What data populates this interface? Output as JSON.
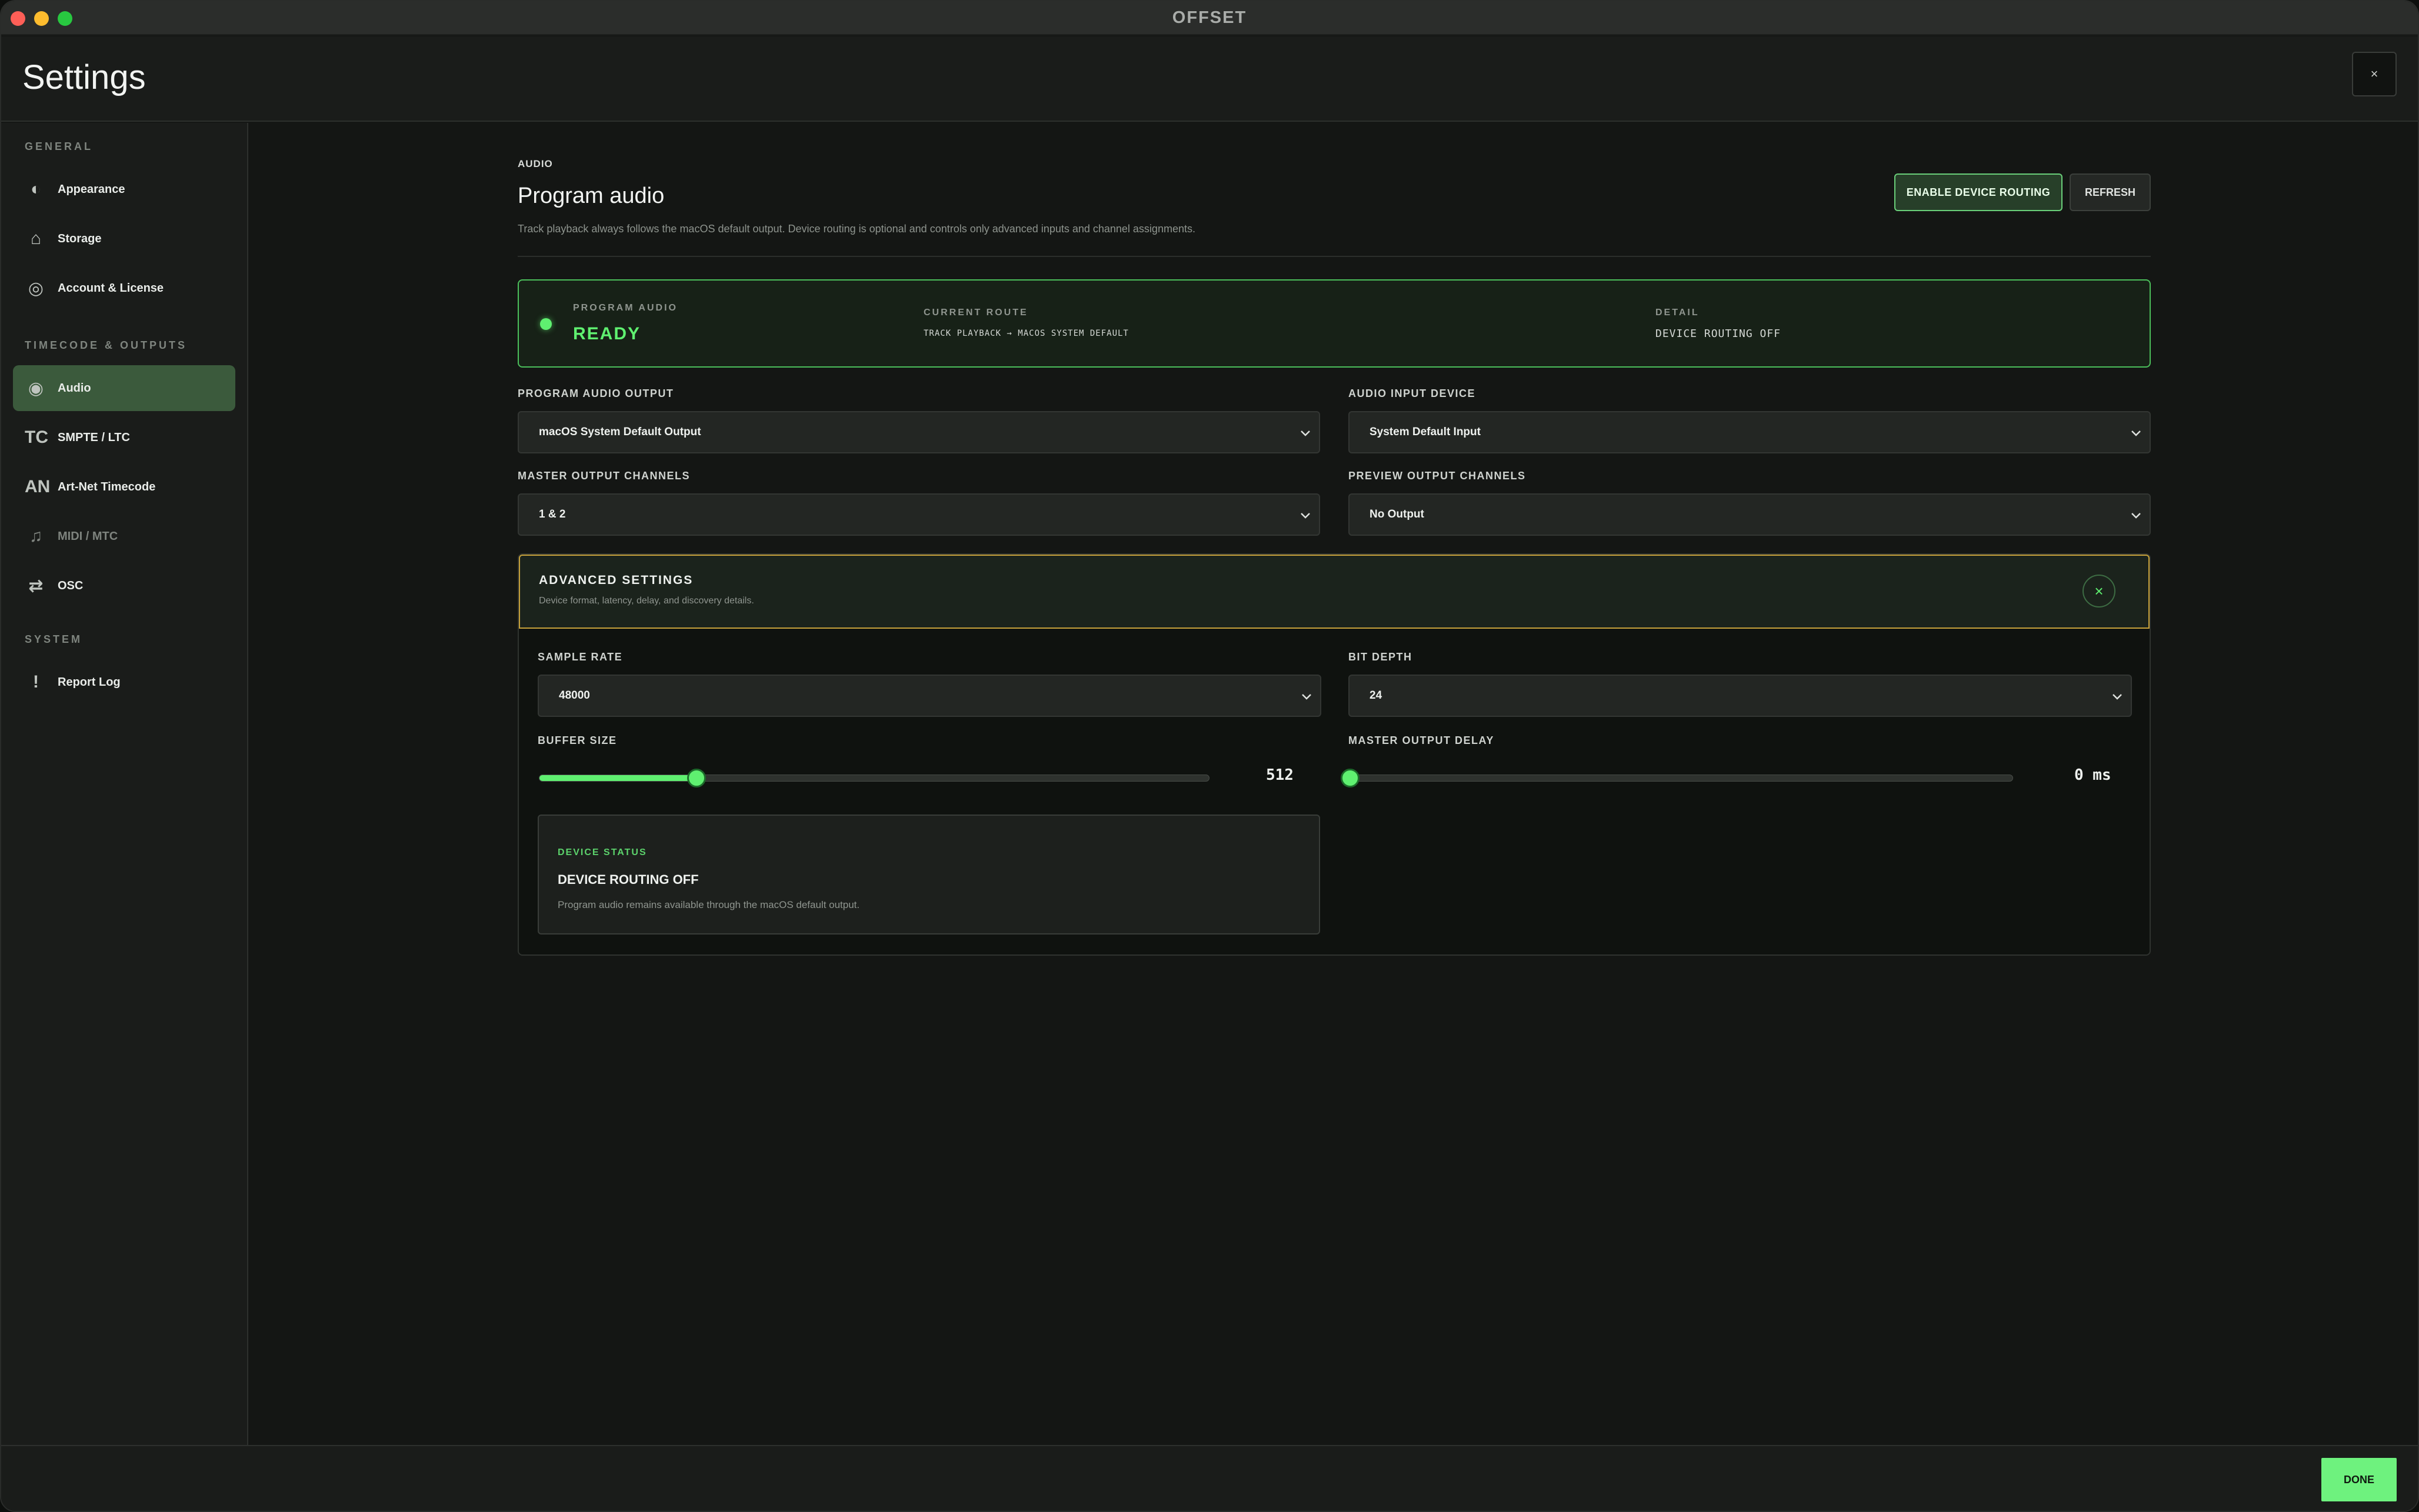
{
  "window": {
    "title": "OFFSET"
  },
  "header": {
    "title": "Settings",
    "close_label": "×"
  },
  "sidebar": {
    "sections": [
      {
        "title": "GENERAL"
      },
      {
        "title": "TIMECODE & OUTPUTS"
      },
      {
        "title": "SYSTEM"
      }
    ],
    "items": [
      {
        "label": "Appearance",
        "icon": "◐"
      },
      {
        "label": "Storage",
        "icon": "⌂"
      },
      {
        "label": "Account & License",
        "icon": "◎"
      },
      {
        "label": "Audio",
        "icon": "◉"
      },
      {
        "label": "SMPTE / LTC",
        "icon": "TC"
      },
      {
        "label": "Art-Net Timecode",
        "icon": "AN"
      },
      {
        "label": "MIDI / MTC",
        "icon": "♫"
      },
      {
        "label": "OSC",
        "icon": "⇄"
      },
      {
        "label": "Report Log",
        "icon": "!"
      }
    ],
    "active": "Audio"
  },
  "main": {
    "eyebrow": "AUDIO",
    "title": "Program audio",
    "description": "Track playback always follows the macOS default output. Device routing is optional and controls only advanced inputs and channel assignments.",
    "buttons": {
      "enable_routing": "ENABLE DEVICE ROUTING",
      "refresh": "REFRESH"
    },
    "status": {
      "program_label": "PROGRAM AUDIO",
      "program_value": "READY",
      "route_label": "CURRENT ROUTE",
      "route_value": "TRACK PLAYBACK → MACOS SYSTEM DEFAULT",
      "detail_label": "DETAIL",
      "detail_value": "DEVICE ROUTING OFF"
    },
    "fields": {
      "program_output": {
        "label": "PROGRAM AUDIO OUTPUT",
        "value": "macOS System Default Output"
      },
      "input_device": {
        "label": "AUDIO INPUT DEVICE",
        "value": "System Default Input"
      },
      "master_channels": {
        "label": "MASTER OUTPUT CHANNELS",
        "value": "1 & 2"
      },
      "preview_channels": {
        "label": "PREVIEW OUTPUT CHANNELS",
        "value": "No Output"
      }
    },
    "advanced": {
      "title": "ADVANCED SETTINGS",
      "subtitle": "Device format, latency, delay, and discovery details.",
      "close_icon": "×",
      "sample_rate": {
        "label": "SAMPLE RATE",
        "value": "48000"
      },
      "bit_depth": {
        "label": "BIT DEPTH",
        "value": "24"
      },
      "buffer_size": {
        "label": "BUFFER SIZE",
        "value": "512",
        "fraction": 0.235
      },
      "output_delay": {
        "label": "MASTER OUTPUT DELAY",
        "value": "0 ms",
        "fraction": 0.0
      },
      "device_status": {
        "label": "DEVICE STATUS",
        "title": "DEVICE ROUTING OFF",
        "text": "Program audio remains available through the macOS default output."
      }
    }
  },
  "footer": {
    "done_label": "DONE"
  },
  "colors": {
    "accent": "#5ff070",
    "advanced_border": "#c7a13a"
  }
}
